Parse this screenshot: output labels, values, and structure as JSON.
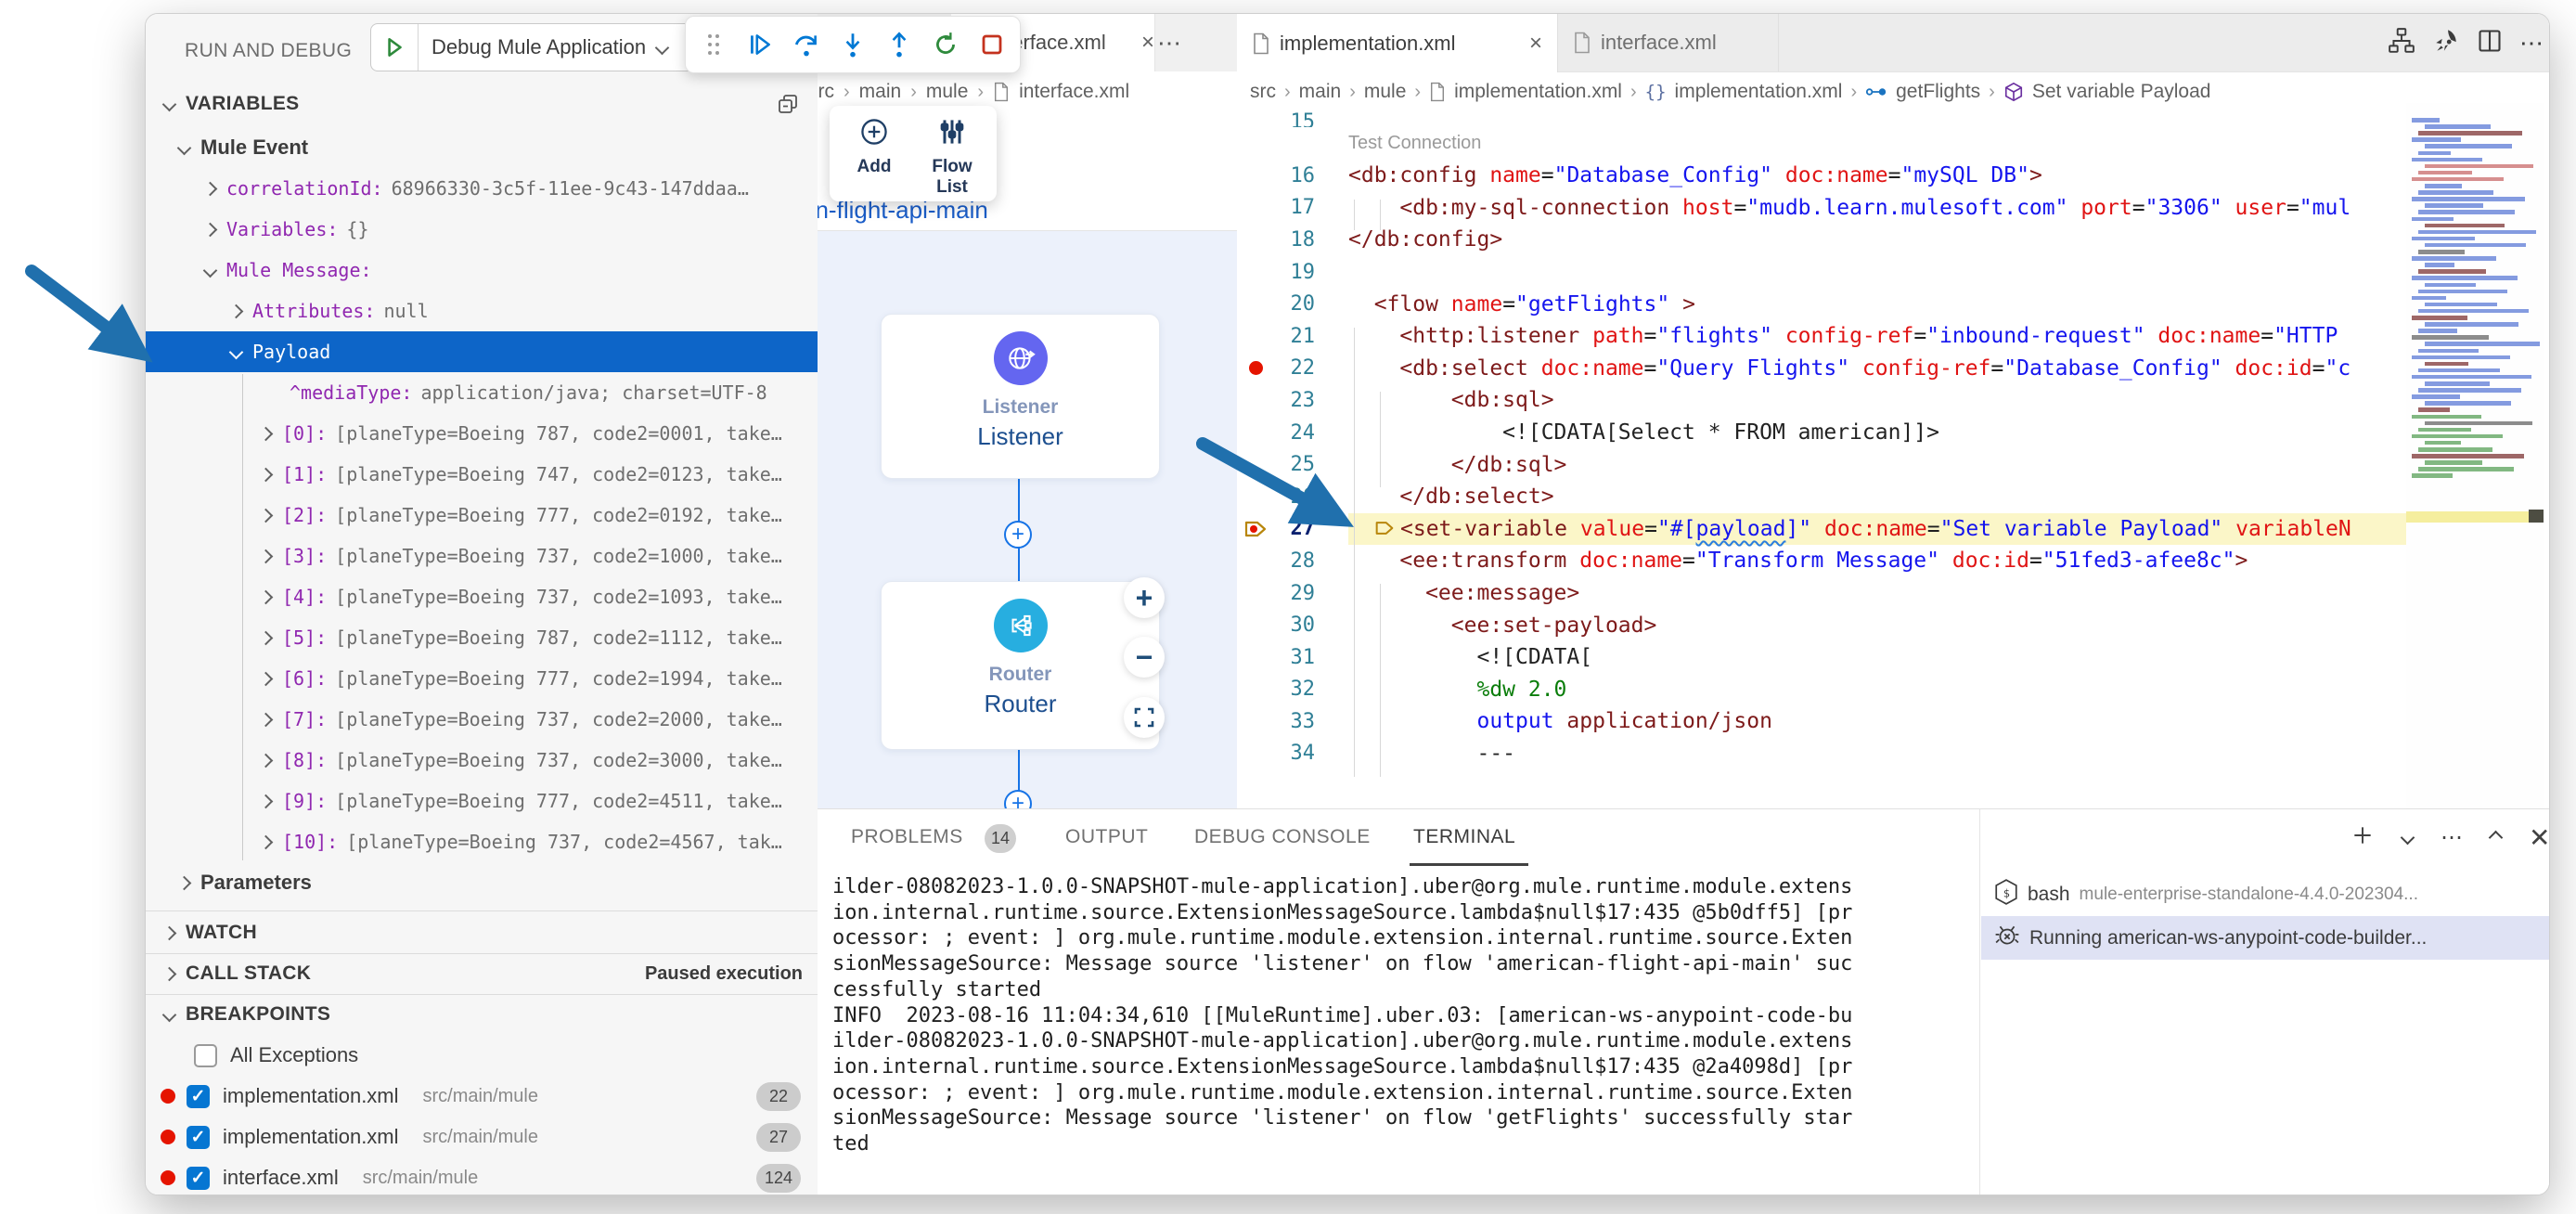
{
  "app": {
    "run_and_debug": "RUN AND DEBUG",
    "launch_config": "Debug Mule Application"
  },
  "sidebar": {
    "variables_title": "VARIABLES",
    "tree": [
      {
        "label": "Mule Event",
        "chev": "down",
        "lvl": 1,
        "bold": true
      },
      {
        "name": "correlationId:",
        "value": "68966330-3c5f-11ee-9c43-147ddaa…",
        "chev": "right",
        "lvl": 2
      },
      {
        "name": "Variables:",
        "value": "{}",
        "chev": "right",
        "lvl": 2
      },
      {
        "name": "Mule Message:",
        "value": "",
        "chev": "down",
        "lvl": 2
      },
      {
        "name": "Attributes:",
        "value": "null",
        "chev": "right",
        "lvl": 3
      },
      {
        "name": "Payload",
        "value": "",
        "chev": "down",
        "lvl": 3,
        "selected": true
      },
      {
        "name": "^mediaType:",
        "value": "application/java; charset=UTF-8",
        "chev": "none",
        "lvl": 4
      },
      {
        "name": "[0]:",
        "value": "[planeType=Boeing 787, code2=0001, take…",
        "chev": "right",
        "lvl": 4
      },
      {
        "name": "[1]:",
        "value": "[planeType=Boeing 747, code2=0123, take…",
        "chev": "right",
        "lvl": 4
      },
      {
        "name": "[2]:",
        "value": "[planeType=Boeing 777, code2=0192, take…",
        "chev": "right",
        "lvl": 4
      },
      {
        "name": "[3]:",
        "value": "[planeType=Boeing 737, code2=1000, take…",
        "chev": "right",
        "lvl": 4
      },
      {
        "name": "[4]:",
        "value": "[planeType=Boeing 737, code2=1093, take…",
        "chev": "right",
        "lvl": 4
      },
      {
        "name": "[5]:",
        "value": "[planeType=Boeing 787, code2=1112, take…",
        "chev": "right",
        "lvl": 4
      },
      {
        "name": "[6]:",
        "value": "[planeType=Boeing 777, code2=1994, take…",
        "chev": "right",
        "lvl": 4
      },
      {
        "name": "[7]:",
        "value": "[planeType=Boeing 737, code2=2000, take…",
        "chev": "right",
        "lvl": 4
      },
      {
        "name": "[8]:",
        "value": "[planeType=Boeing 737, code2=3000, take…",
        "chev": "right",
        "lvl": 4
      },
      {
        "name": "[9]:",
        "value": "[planeType=Boeing 777, code2=4511, take…",
        "chev": "right",
        "lvl": 4
      },
      {
        "name": "[10]:",
        "value": "[planeType=Boeing 737, code2=4567, tak…",
        "chev": "right",
        "lvl": 4
      },
      {
        "label": "Parameters",
        "chev": "right",
        "lvl": 1,
        "bold": true
      }
    ],
    "watch_title": "WATCH",
    "call_stack_title": "CALL STACK",
    "call_stack_status": "Paused execution",
    "breakpoints_title": "BREAKPOINTS",
    "all_exceptions": "All Exceptions",
    "breakpoints": [
      {
        "file": "implementation.xml",
        "path": "src/main/mule",
        "line": "22"
      },
      {
        "file": "implementation.xml",
        "path": "src/main/mule",
        "line": "27"
      },
      {
        "file": "interface.xml",
        "path": "src/main/mule",
        "line": "124"
      }
    ]
  },
  "canvas": {
    "tab_label": "interface.xml",
    "breadcrumb": [
      "src",
      "main",
      "mule",
      "interface.xml"
    ],
    "toolbar": {
      "add": "Add",
      "flow_list": "Flow List"
    },
    "flow_title": "american-flight-api-main",
    "nodes": [
      {
        "type": "Listener",
        "name": "Listener"
      },
      {
        "type": "Router",
        "name": "Router"
      }
    ]
  },
  "editor": {
    "tabs": [
      {
        "label": "implementation.xml"
      },
      {
        "label": "interface.xml"
      }
    ],
    "breadcrumb": [
      "src",
      "main",
      "mule",
      "implementation.xml",
      "implementation.xml",
      "getFlights",
      "Set variable Payload"
    ],
    "codelens": "Test Connection",
    "clipped_line_number": "15",
    "lines": [
      {
        "n": "16",
        "tokens": [
          [
            "tg",
            "<db:config"
          ],
          [
            "at",
            " name"
          ],
          [
            "pn",
            "="
          ],
          [
            "vl",
            "\"Database_Config\""
          ],
          [
            "at",
            " doc:name"
          ],
          [
            "pn",
            "="
          ],
          [
            "vl",
            "\"mySQL DB\""
          ],
          [
            "tg",
            ">"
          ]
        ]
      },
      {
        "n": "17",
        "tokens": [
          [
            "tg",
            "    <db:my-sql-connection"
          ],
          [
            "at",
            " host"
          ],
          [
            "pn",
            "="
          ],
          [
            "vl",
            "\"mudb.learn.mulesoft.com\""
          ],
          [
            "at",
            " port"
          ],
          [
            "pn",
            "="
          ],
          [
            "vl",
            "\"3306\""
          ],
          [
            "at",
            " user"
          ],
          [
            "pn",
            "="
          ],
          [
            "vl",
            "\"mul"
          ]
        ]
      },
      {
        "n": "18",
        "tokens": [
          [
            "tg",
            "</db:config>"
          ]
        ]
      },
      {
        "n": "19",
        "tokens": []
      },
      {
        "n": "20",
        "tokens": [
          [
            "tg",
            "  <flow"
          ],
          [
            "at",
            " name"
          ],
          [
            "pn",
            "="
          ],
          [
            "vl",
            "\"getFlights\""
          ],
          [
            "tg",
            " >"
          ]
        ]
      },
      {
        "n": "21",
        "tokens": [
          [
            "tg",
            "    <http:listener"
          ],
          [
            "at",
            " path"
          ],
          [
            "pn",
            "="
          ],
          [
            "vl",
            "\"flights\""
          ],
          [
            "at",
            " config-ref"
          ],
          [
            "pn",
            "="
          ],
          [
            "vl",
            "\"inbound-request\""
          ],
          [
            "at",
            " doc:name"
          ],
          [
            "pn",
            "="
          ],
          [
            "vl",
            "\"HTTP"
          ]
        ]
      },
      {
        "n": "22",
        "bp": true,
        "tokens": [
          [
            "tg",
            "    <db:select"
          ],
          [
            "at",
            " doc:name"
          ],
          [
            "pn",
            "="
          ],
          [
            "vl",
            "\"Query Flights\""
          ],
          [
            "at",
            " config-ref"
          ],
          [
            "pn",
            "="
          ],
          [
            "vl",
            "\"Database_Config\""
          ],
          [
            "at",
            " doc:id"
          ],
          [
            "pn",
            "="
          ],
          [
            "vl",
            "\"c"
          ]
        ]
      },
      {
        "n": "23",
        "tokens": [
          [
            "tg",
            "        <db:sql>"
          ]
        ]
      },
      {
        "n": "24",
        "tokens": [
          [
            "tx",
            "            <![CDATA[Select * FROM american]]>"
          ]
        ]
      },
      {
        "n": "25",
        "tokens": [
          [
            "tg",
            "        </db:sql>"
          ]
        ]
      },
      {
        "n": "26",
        "tokens": [
          [
            "tg",
            "    </db:select>"
          ]
        ]
      },
      {
        "n": "27",
        "cur": true,
        "tokens": [
          [
            "ic",
            ""
          ],
          [
            "tg",
            "<set-variable"
          ],
          [
            "at",
            " value"
          ],
          [
            "pn",
            "="
          ],
          [
            "vl",
            "\"#["
          ],
          [
            "sq",
            "payload"
          ],
          [
            "vl",
            "]\""
          ],
          [
            "at",
            " doc:name"
          ],
          [
            "pn",
            "="
          ],
          [
            "vl",
            "\"Set variable Payload\""
          ],
          [
            "at",
            " variableN"
          ]
        ]
      },
      {
        "n": "28",
        "tokens": [
          [
            "tg",
            "    <ee:transform"
          ],
          [
            "at",
            " doc:name"
          ],
          [
            "pn",
            "="
          ],
          [
            "vl",
            "\"Transform Message\""
          ],
          [
            "at",
            " doc:id"
          ],
          [
            "pn",
            "="
          ],
          [
            "vl",
            "\"51fed3-afee8c\""
          ],
          [
            "tg",
            ">"
          ]
        ]
      },
      {
        "n": "29",
        "tokens": [
          [
            "tg",
            "      <ee:message>"
          ]
        ]
      },
      {
        "n": "30",
        "tokens": [
          [
            "tg",
            "        <ee:set-payload>"
          ]
        ]
      },
      {
        "n": "31",
        "tokens": [
          [
            "tx",
            "          <![CDATA["
          ]
        ]
      },
      {
        "n": "32",
        "tokens": [
          [
            "gr",
            "          %dw 2.0"
          ]
        ]
      },
      {
        "n": "33",
        "tokens": [
          [
            "kw",
            "          output"
          ],
          [
            "mr",
            " application/json"
          ]
        ]
      },
      {
        "n": "34",
        "tokens": [
          [
            "tx",
            "          ---"
          ]
        ]
      }
    ]
  },
  "panel": {
    "tabs": [
      {
        "label": "PROBLEMS",
        "badge": "14"
      },
      {
        "label": "OUTPUT"
      },
      {
        "label": "DEBUG CONSOLE"
      },
      {
        "label": "TERMINAL",
        "active": true
      }
    ],
    "terminal_lines": [
      "ilder-08082023-1.0.0-SNAPSHOT-mule-application].uber@org.mule.runtime.module.extens",
      "ion.internal.runtime.source.ExtensionMessageSource.lambda$null$17:435 @5b0dff5] [pr",
      "ocessor: ; event: ] org.mule.runtime.module.extension.internal.runtime.source.Exten",
      "sionMessageSource: Message source 'listener' on flow 'american-flight-api-main' suc",
      "cessfully started",
      "INFO  2023-08-16 11:04:34,610 [[MuleRuntime].uber.03: [american-ws-anypoint-code-bu",
      "ilder-08082023-1.0.0-SNAPSHOT-mule-application].uber@org.mule.runtime.module.extens",
      "ion.internal.runtime.source.ExtensionMessageSource.lambda$null$17:435 @2a4098d] [pr",
      "ocessor: ; event: ] org.mule.runtime.module.extension.internal.runtime.source.Exten",
      "sionMessageSource: Message source 'listener' on flow 'getFlights' successfully star",
      "ted"
    ],
    "sessions": [
      {
        "kind": "bash",
        "name": "bash",
        "desc": "mule-enterprise-standalone-4.4.0-202304..."
      },
      {
        "kind": "debug",
        "name": "Running american-ws-anypoint-code-builder...",
        "selected": true
      }
    ]
  },
  "colors": {
    "selection_blue": "#0d65c8",
    "breakpoint_red": "#e51400",
    "listener_icon": "#6466f0",
    "router_icon": "#27aee0",
    "connector_blue": "#1673e6",
    "current_line": "#fbf6c8",
    "arrow_blue": "#2070ad"
  }
}
